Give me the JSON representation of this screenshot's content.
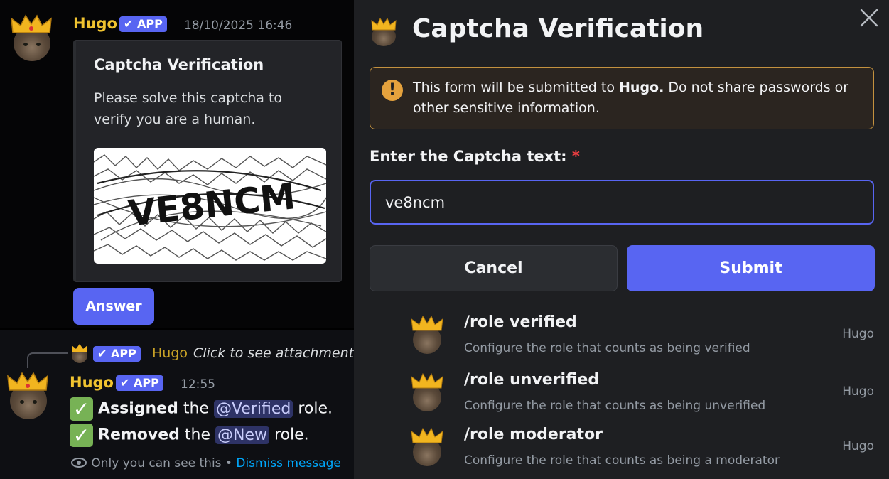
{
  "message": {
    "username": "Hugo",
    "badge": "✔ APP",
    "timestamp": "18/10/2025 16:46",
    "embed_title": "Captcha Verification",
    "embed_description": "Please solve this captcha to verify you are a human.",
    "captcha_text": "VE8NCM",
    "answer_label": "Answer"
  },
  "reply": {
    "badge": "✔ APP",
    "username": "Hugo",
    "preview": "Click to see attachment",
    "author": "Hugo",
    "author_badge": "✔ APP",
    "timestamp": "12:55",
    "line1": {
      "bold": "Assigned",
      "mid": " the ",
      "mention": "@Verified",
      "end": " role."
    },
    "line2": {
      "bold": "Removed",
      "mid": " the ",
      "mention": "@New",
      "end": " role."
    },
    "ephemeral_text": "Only you can see this",
    "separator": " • ",
    "dismiss_label": "Dismiss message"
  },
  "modal": {
    "title": "Captcha Verification",
    "warning_pre": "This form will be submitted to ",
    "warning_bot": "Hugo.",
    "warning_post": " Do not share passwords or other sensitive information.",
    "field_label": "Enter the Captcha text:",
    "required_mark": "*",
    "input_value": "ve8ncm",
    "cancel_label": "Cancel",
    "submit_label": "Submit"
  },
  "commands": [
    {
      "name": "/role verified",
      "description": "Configure the role that counts as being verified",
      "owner": "Hugo"
    },
    {
      "name": "/role unverified",
      "description": "Configure the role that counts as being unverified",
      "owner": "Hugo"
    },
    {
      "name": "/role moderator",
      "description": "Configure the role that counts as being a moderator",
      "owner": "Hugo"
    }
  ],
  "colors": {
    "accent": "#5865f2",
    "username": "#f0c330",
    "warning_border": "#c3913f",
    "link": "#00a8fc",
    "check": "#77b255"
  }
}
